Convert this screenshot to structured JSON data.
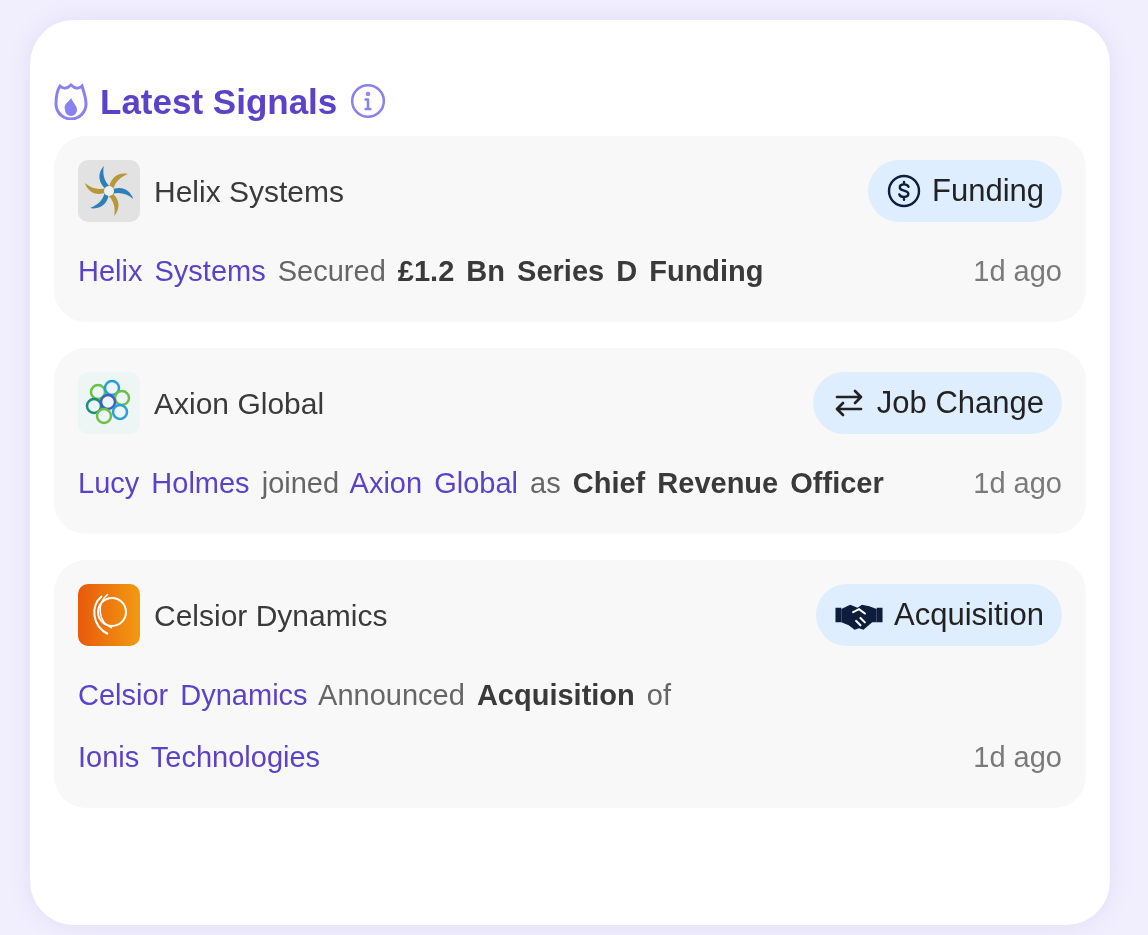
{
  "title": "Latest Signals",
  "signals": [
    {
      "company": "Helix Systems",
      "logo": {
        "kind": "swirl"
      },
      "tag": {
        "kind": "funding",
        "label": "Funding"
      },
      "message": [
        {
          "kind": "link",
          "text": "Helix Systems"
        },
        {
          "kind": "plain",
          "text": "Secured"
        },
        {
          "kind": "bold",
          "text": "£1.2 Bn"
        },
        {
          "kind": "bold",
          "text": "Series D Funding"
        }
      ],
      "time": "1d ago"
    },
    {
      "company": "Axion Global",
      "logo": {
        "kind": "rings"
      },
      "tag": {
        "kind": "job_change",
        "label": "Job Change"
      },
      "message": [
        {
          "kind": "link",
          "text": "Lucy Holmes"
        },
        {
          "kind": "plain",
          "text": "joined"
        },
        {
          "kind": "link",
          "text": "Axion Global"
        },
        {
          "kind": "plain",
          "text": "as"
        },
        {
          "kind": "bold",
          "text": "Chief Revenue Officer"
        }
      ],
      "time": "1d ago"
    },
    {
      "company": "Celsior Dynamics",
      "logo": {
        "kind": "arcs"
      },
      "tag": {
        "kind": "acquisition",
        "label": "Acquisition"
      },
      "message": [
        {
          "kind": "link",
          "text": "Celsior Dynamics"
        },
        {
          "kind": "plain",
          "text": "Announced"
        },
        {
          "kind": "bold",
          "text": "Acquisition"
        },
        {
          "kind": "plain",
          "text": "of"
        },
        {
          "kind": "link",
          "text": "Ionis Technologies"
        }
      ],
      "time": "1d ago"
    }
  ]
}
